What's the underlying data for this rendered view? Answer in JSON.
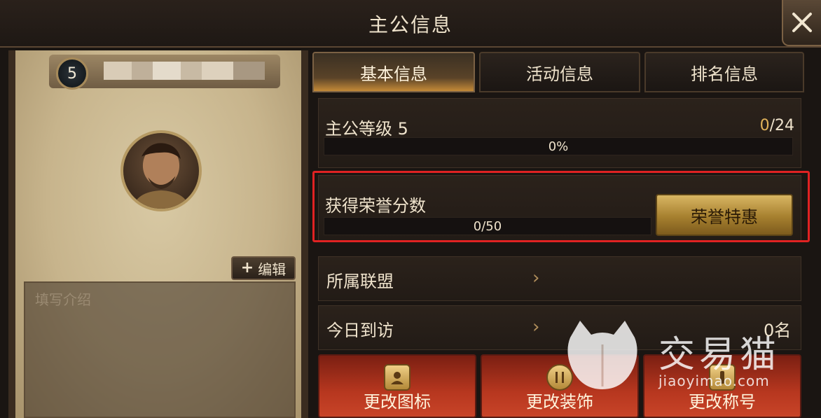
{
  "window": {
    "title": "主公信息"
  },
  "profile": {
    "level": "5",
    "edit_label": "编辑",
    "intro_placeholder": "填写介绍"
  },
  "tabs": [
    {
      "label": "基本信息",
      "active": true
    },
    {
      "label": "活动信息",
      "active": false
    },
    {
      "label": "排名信息",
      "active": false
    }
  ],
  "lord_level": {
    "label": "主公等级 5",
    "current": "0",
    "separator": "/",
    "max": "24",
    "progress_text": "0%",
    "progress": 0
  },
  "honor": {
    "label": "获得荣誉分数",
    "progress_text": "0/50",
    "progress": 0,
    "button_label": "荣誉特惠"
  },
  "alliance": {
    "label": "所属联盟"
  },
  "visits": {
    "label": "今日到访",
    "value": "0名"
  },
  "actions": [
    {
      "label": "更改图标",
      "icon": "portrait-icon"
    },
    {
      "label": "更改装饰",
      "icon": "frame-icon"
    },
    {
      "label": "更改称号",
      "icon": "title-icon"
    }
  ],
  "watermark": {
    "main": "交易猫",
    "sub": "jiaoyimao.com"
  },
  "colors": {
    "highlight": "#e02222",
    "accent_gold": "#e2b35a",
    "action_red": "#b7371f"
  }
}
